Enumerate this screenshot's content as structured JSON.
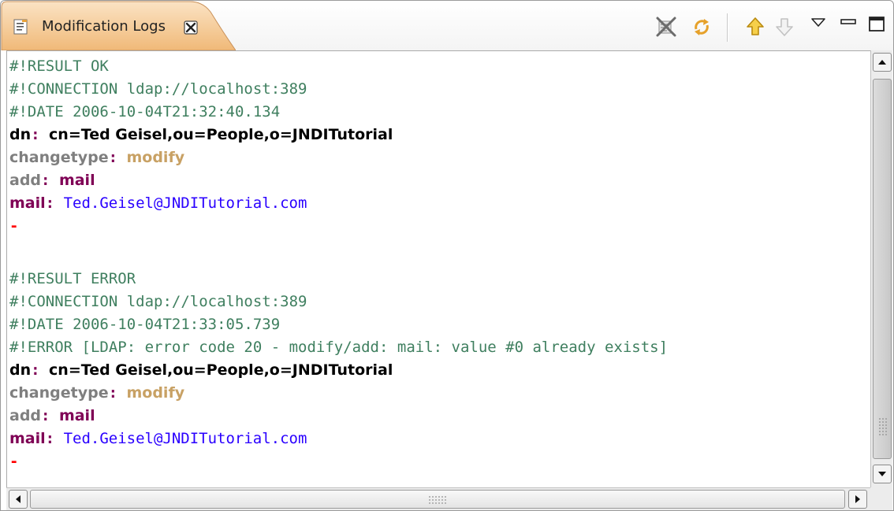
{
  "tab": {
    "title": "Modification Logs",
    "icon": "document-icon",
    "close_icon": "close-icon"
  },
  "toolbar": {
    "buttons": [
      {
        "name": "clear-log-button",
        "icon": "clear-icon"
      },
      {
        "name": "refresh-button",
        "icon": "refresh-icon"
      },
      {
        "name": "older-logs-button",
        "icon": "arrow-up-icon"
      },
      {
        "name": "newer-logs-button",
        "icon": "arrow-down-icon"
      },
      {
        "name": "view-menu-button",
        "icon": "view-menu-icon"
      },
      {
        "name": "minimize-button",
        "icon": "minimize-icon"
      },
      {
        "name": "maximize-button",
        "icon": "maximize-icon"
      }
    ]
  },
  "log": {
    "entries": [
      {
        "result": "#!RESULT OK",
        "connection": "#!CONNECTION ldap://localhost:389",
        "date": "#!DATE 2006-10-04T21:32:40.134",
        "dn_key": "dn",
        "dn_value": "cn=Ted Geisel,ou=People,o=JNDITutorial",
        "changetype_key": "changetype",
        "changetype_value": "modify",
        "add_key": "add",
        "add_value": "mail",
        "mail_key": "mail",
        "mail_value": "Ted.Geisel@JNDITutorial.com",
        "terminator": "-"
      },
      {
        "result": "#!RESULT ERROR",
        "connection": "#!CONNECTION ldap://localhost:389",
        "date": "#!DATE 2006-10-04T21:33:05.739",
        "error": "#!ERROR [LDAP: error code 20 - modify/add: mail: value #0 already exists]",
        "dn_key": "dn",
        "dn_value": "cn=Ted Geisel,ou=People,o=JNDITutorial",
        "changetype_key": "changetype",
        "changetype_value": "modify",
        "add_key": "add",
        "add_value": "mail",
        "mail_key": "mail",
        "mail_value": "Ted.Geisel@JNDITutorial.com",
        "terminator": "-"
      }
    ],
    "separator": ":"
  },
  "colors": {
    "comment": "#3f7f5f",
    "attribute": "#000000",
    "changetype": "#7f7f7f",
    "modify": "#c8a164",
    "operation": "#7f0055",
    "value": "#2a00ff",
    "terminator": "#ff0000",
    "tab_accent": "#f3c691"
  }
}
